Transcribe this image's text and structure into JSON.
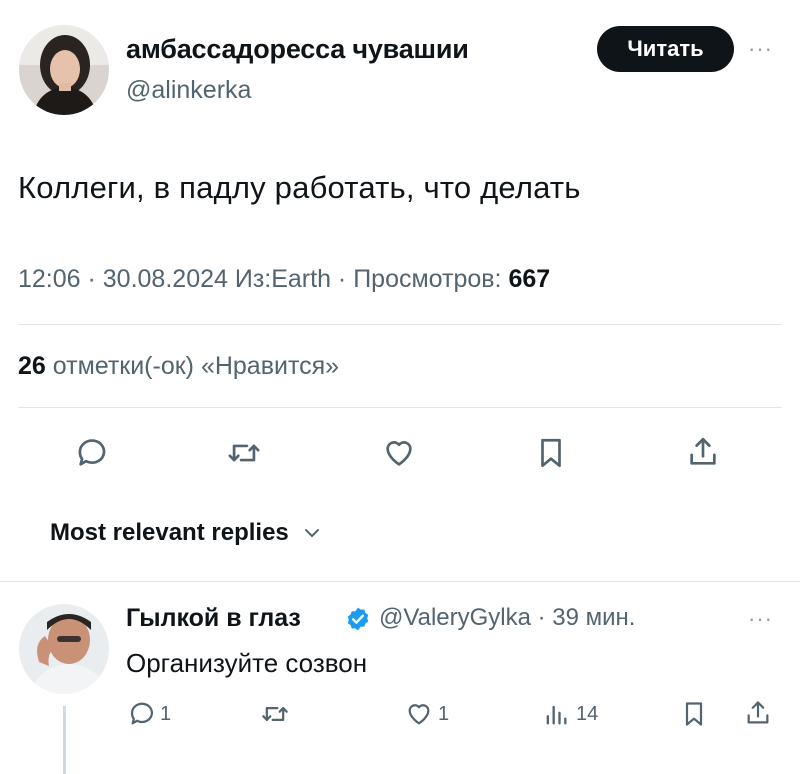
{
  "tweet": {
    "author_name": "амбассадоресса чувашии",
    "author_handle": "@alinkerka",
    "follow_label": "Читать",
    "more_label": "···",
    "text": "Коллеги, в падлу работать, что делать",
    "meta_prefix": "12:06 · 30.08.2024 Из:Earth · Просмотров: ",
    "views": "667",
    "likes_count": "26",
    "likes_label": " отметки(-ок) «Нравится»"
  },
  "replies_section": {
    "sort_label": "Most relevant replies"
  },
  "reply": {
    "author_name": "Гылкой в глаз",
    "handle_time": "@ValeryGylka · 39 мин.",
    "more_label": "···",
    "text": "Организуйте созвон",
    "replies_count": "1",
    "likes_count": "1",
    "views_count": "14"
  },
  "colors": {
    "text": "#0f1419",
    "secondary": "#536471",
    "verified": "#1d9bf0",
    "follow_bg": "#0f1419"
  },
  "icons": [
    "comment-icon",
    "retweet-icon",
    "heart-icon",
    "bookmark-icon",
    "share-icon",
    "views-icon",
    "verified-icon",
    "chevron-down-icon"
  ]
}
